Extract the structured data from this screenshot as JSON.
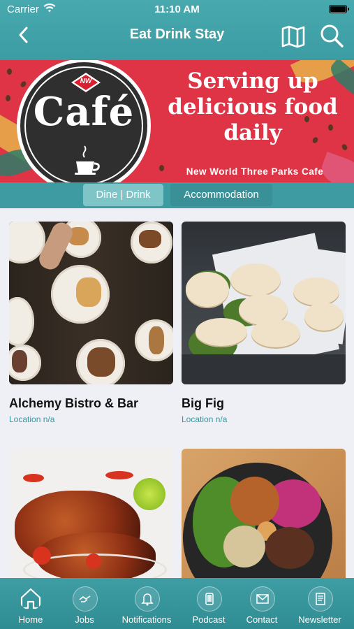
{
  "status_bar": {
    "carrier": "Carrier",
    "time": "11:10 AM"
  },
  "nav": {
    "title": "Eat Drink Stay",
    "back_icon": "chevron-left-icon",
    "map_icon": "map-icon",
    "search_icon": "search-icon"
  },
  "banner": {
    "badge_text": "NW",
    "logo_word": "Café",
    "headline_line1": "Serving up",
    "headline_line2": "delicious food",
    "headline_line3": "daily",
    "subline": "New World Three Parks Cafe",
    "colors": {
      "background": "#df3446",
      "logo": "#2f2f2f"
    }
  },
  "tabs": [
    {
      "label": "Dine | Drink",
      "active": true
    },
    {
      "label": "Accommodation",
      "active": false
    }
  ],
  "listings": [
    {
      "name": "Alchemy Bistro & Bar",
      "location": "Location n/a"
    },
    {
      "name": "Big Fig",
      "location": "Location n/a"
    },
    {
      "name": "",
      "location": ""
    },
    {
      "name": "",
      "location": ""
    }
  ],
  "tabbar": [
    {
      "label": "Home",
      "icon": "home-icon",
      "active": true
    },
    {
      "label": "Jobs",
      "icon": "handshake-icon",
      "active": false
    },
    {
      "label": "Notifications",
      "icon": "bell-icon",
      "active": false
    },
    {
      "label": "Podcast",
      "icon": "phone-icon",
      "active": false
    },
    {
      "label": "Contact",
      "icon": "mail-icon",
      "active": false
    },
    {
      "label": "Newsletter",
      "icon": "newsletter-icon",
      "active": false
    }
  ],
  "colors": {
    "accent": "#3e9ba1",
    "location_text": "#3b98a0",
    "page_background": "#eef0f5"
  }
}
